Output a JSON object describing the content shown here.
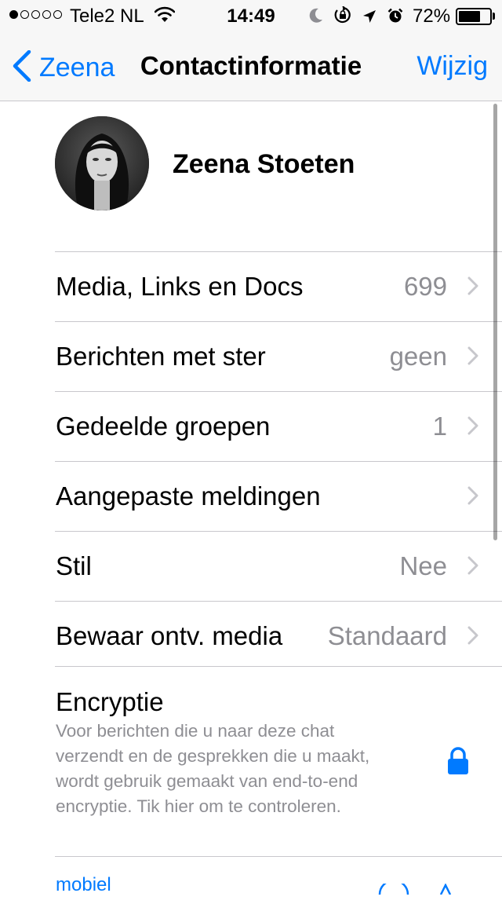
{
  "status_bar": {
    "signal_dots_filled": 1,
    "signal_dots_total": 5,
    "carrier": "Tele2 NL",
    "time": "14:49",
    "icons": [
      "wifi-icon",
      "moon-icon",
      "rotation-lock-icon",
      "location-arrow-icon",
      "alarm-icon"
    ],
    "battery_percent": "72%",
    "battery_level": 0.72
  },
  "nav": {
    "back_label": "Zeena",
    "title": "Contactinformatie",
    "edit_label": "Wijzig",
    "accent_color": "#007aff"
  },
  "profile": {
    "name": "Zeena Stoeten"
  },
  "rows": [
    {
      "label": "Media, Links en Docs",
      "value": "699"
    },
    {
      "label": "Berichten met ster",
      "value": "geen"
    },
    {
      "label": "Gedeelde groepen",
      "value": "1"
    },
    {
      "label": "Aangepaste meldingen",
      "value": ""
    },
    {
      "label": "Stil",
      "value": "Nee"
    },
    {
      "label": "Bewaar ontv. media",
      "value": "Standaard"
    }
  ],
  "encryption": {
    "title": "Encryptie",
    "description": "Voor berichten die u naar deze chat verzendt en de gesprekken die u maakt, wordt gebruik gemaakt van end-to-end encryptie. Tik hier om te controleren."
  },
  "phone": {
    "label": "mobiel"
  },
  "colors": {
    "separator": "#c8c7cc",
    "secondary_text": "#8e8e93",
    "bar_background": "#f7f7f7"
  }
}
